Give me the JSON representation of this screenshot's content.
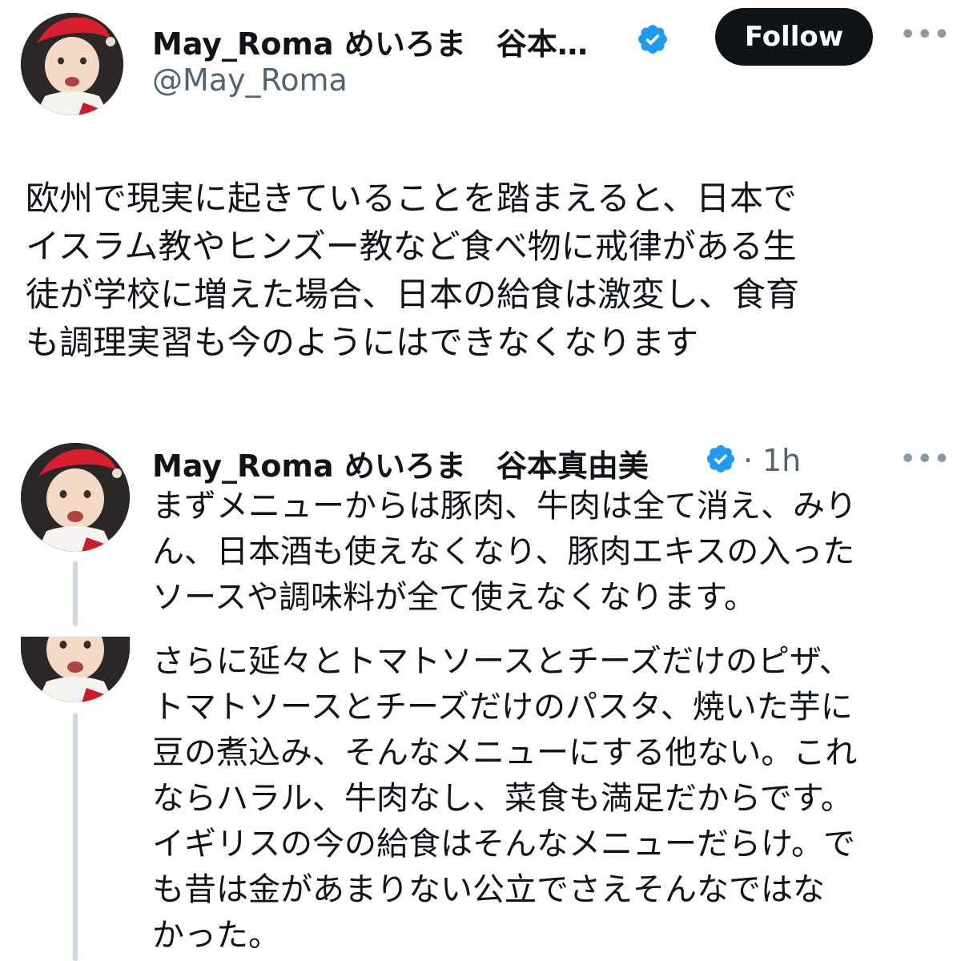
{
  "main_tweet": {
    "author_name": "May_Roma めいろま　谷本…",
    "handle": "@May_Roma",
    "follow_label": "Follow",
    "more_icon": "more-horizontal-icon",
    "text": "欧州で現実に起きていることを踏まえると、日本で\nイスラム教やヒンズー教など食べ物に戒律がある生\n徒が学校に増えた場合、日本の給食は激変し、食育\nも調理実習も今のようにはできなくなります"
  },
  "reply_tweet": {
    "author_name": "May_Roma めいろま　谷本真由美",
    "separator": "·",
    "timestamp": "1h",
    "more_icon": "more-horizontal-icon",
    "text": "まずメニューからは豚肉、牛肉は全て消え、みり\nん、日本酒も使えなくなり、豚肉エキスの入った\nソースや調味料が全て使えなくなります。"
  },
  "continued_tweet": {
    "text": "さらに延々とトマトソースとチーズだけのピザ、\nトマトソースとチーズだけのパスタ、焼いた芋に\n豆の煮込み、そんなメニューにする他ない。これ\nならハラル、牛肉なし、菜食も満足だからです。\nイギリスの今の給食はそんなメニューだらけ。で\nも昔は金があまりない公立でさえそんなではな\nかった。"
  },
  "colors": {
    "verified_blue": "#1d9bf0",
    "follow_bg": "#0f1419",
    "secondary_text": "#536471",
    "thread_line": "#cfd9de"
  }
}
